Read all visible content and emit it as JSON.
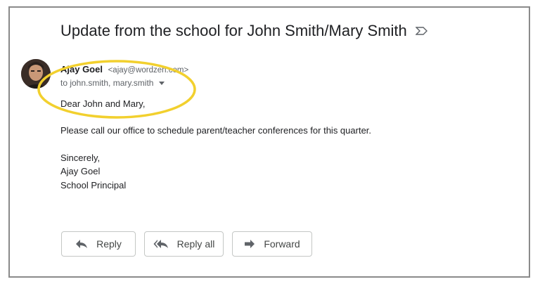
{
  "email": {
    "subject": "Update from the school for John Smith/Mary Smith",
    "sender_name": "Ajay Goel",
    "sender_email": "<ajay@wordzen.com>",
    "recipients": "to john.smith, mary.smith",
    "greeting": "Dear John and Mary,",
    "message": "Please call our office to schedule parent/teacher conferences for this quarter.",
    "signoff": "Sincerely,",
    "signature_name": "Ajay Goel",
    "signature_title": "School Principal"
  },
  "actions": {
    "reply_label": "Reply",
    "reply_all_label": "Reply all",
    "forward_label": "Forward"
  },
  "colors": {
    "highlight": "#f2d02e",
    "frame": "#8a8a8a"
  },
  "icons": [
    "label-icon",
    "avatar",
    "chevron-down-icon",
    "reply-icon",
    "reply-all-icon",
    "forward-icon"
  ]
}
